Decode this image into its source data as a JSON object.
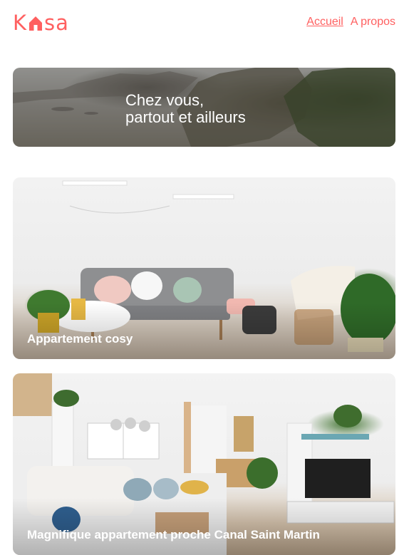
{
  "brand": {
    "logo_text_start": "K",
    "logo_text_end": "sa",
    "accent_color": "#ff6060"
  },
  "nav": {
    "home_label": "Accueil",
    "about_label": "A propos"
  },
  "banner": {
    "line1": "Chez vous,",
    "line2": "partout et ailleurs"
  },
  "listings": [
    {
      "title": "Appartement cosy"
    },
    {
      "title": "Magnifique appartement proche Canal Saint Martin"
    }
  ]
}
